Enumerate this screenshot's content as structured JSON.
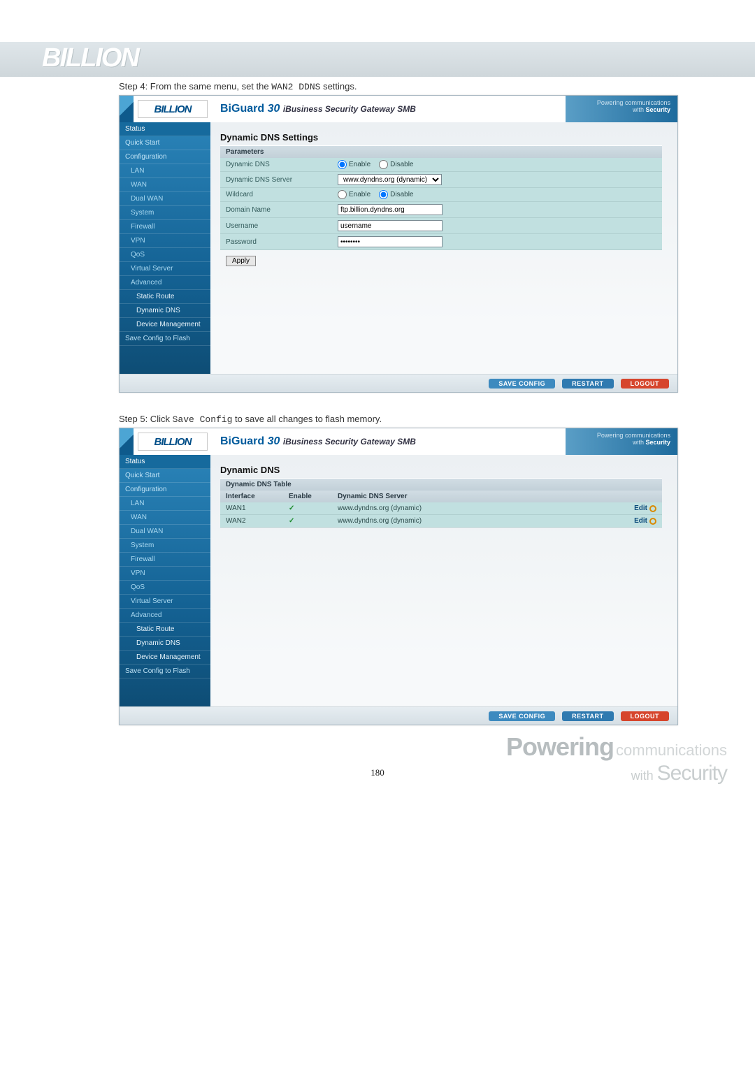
{
  "top_logo": "BILLION",
  "steps": {
    "s4_a": "Step 4: From the same menu, set the ",
    "s4_b": "WAN2 DDNS",
    "s4_c": " settings.",
    "s5_a": "Step 5: Click ",
    "s5_b": "Save Config",
    "s5_c": " to save all changes to flash memory."
  },
  "router": {
    "logo": "BILLION",
    "product_bi": "Bi",
    "product_guard": "Guard",
    "product_num": " 30 ",
    "product_sub": "iBusiness Security Gateway SMB",
    "powering1": "Powering",
    "powering2": "communications",
    "powering3": "with ",
    "powering4": "Security"
  },
  "sidebar": {
    "items": [
      "Status",
      "Quick Start",
      "Configuration",
      "LAN",
      "WAN",
      "Dual WAN",
      "System",
      "Firewall",
      "VPN",
      "QoS",
      "Virtual Server",
      "Advanced",
      "Static Route",
      "Dynamic DNS",
      "Device Management",
      "Save Config to Flash"
    ]
  },
  "ddns_settings": {
    "title": "Dynamic DNS Settings",
    "params_label": "Parameters",
    "rows": {
      "dynamic_dns": "Dynamic DNS",
      "server": "Dynamic DNS Server",
      "wildcard": "Wildcard",
      "domain": "Domain Name",
      "username": "Username",
      "password": "Password"
    },
    "values": {
      "server_select": "www.dyndns.org (dynamic)",
      "domain": "ftp.billion.dyndns.org",
      "username": "username",
      "password": "••••••••",
      "enable": "Enable",
      "disable": "Disable"
    },
    "apply": "Apply"
  },
  "ddns_table": {
    "title": "Dynamic DNS",
    "table_label": "Dynamic DNS Table",
    "columns": {
      "if": "Interface",
      "en": "Enable",
      "srv": "Dynamic DNS Server"
    },
    "rows": [
      {
        "if": "WAN1",
        "en": "✓",
        "srv": "www.dyndns.org (dynamic)",
        "act": "Edit"
      },
      {
        "if": "WAN2",
        "en": "✓",
        "srv": "www.dyndns.org (dynamic)",
        "act": "Edit"
      }
    ]
  },
  "footer": {
    "save": "SAVE CONFIG",
    "restart": "RESTART",
    "logout": "LOGOUT"
  },
  "page_number": "180",
  "bottom_brand": {
    "p": "Powering",
    "c": " communications",
    "with": "with ",
    "sec": "Security"
  }
}
